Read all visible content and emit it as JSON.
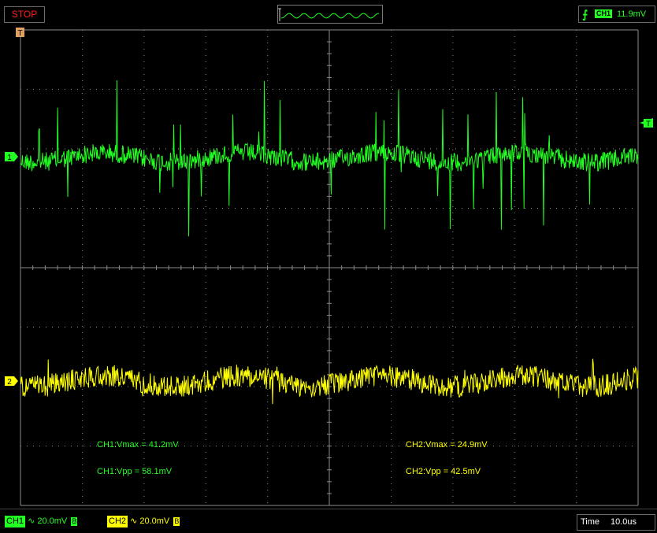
{
  "header": {
    "status_button": "STOP",
    "trigger": {
      "channel": "CH1",
      "level": "11.9mV",
      "edge_icon": "rising-edge-icon"
    }
  },
  "measurements": {
    "ch1_vmax": "CH1:Vmax = 41.2mV",
    "ch1_vpp": "CH1:Vpp = 58.1mV",
    "ch2_vmax": "CH2:Vmax = 24.9mV",
    "ch2_vpp": "CH2:Vpp = 42.5mV"
  },
  "markers": {
    "ch1": "1",
    "ch2": "2",
    "trigger_pos": "T",
    "trigger_level": "T"
  },
  "footer": {
    "ch1": {
      "label": "CH1",
      "coupling": "∿",
      "scale": "20.0mV",
      "bw": "B"
    },
    "ch2": {
      "label": "CH2",
      "coupling": "∿",
      "scale": "20.0mV",
      "bw": "B"
    },
    "time_label": "Time",
    "time_scale": "10.0us"
  },
  "colors": {
    "ch1": "#22ff22",
    "ch2": "#ffff00",
    "grid": "#8a8a8a",
    "stop": "#ff1e1e"
  }
}
